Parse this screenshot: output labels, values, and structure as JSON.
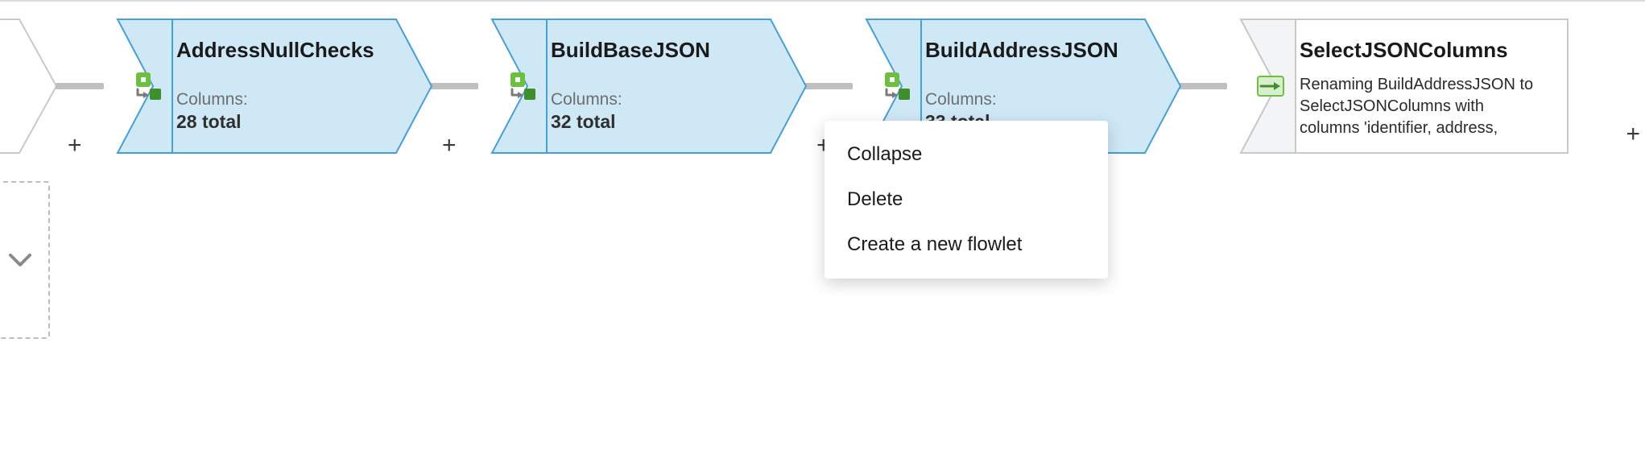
{
  "flow": {
    "source_fragment": {
      "plus_glyph": "+"
    },
    "nodes": [
      {
        "id": "n1",
        "kind": "derived",
        "title": "AddressNullChecks",
        "columns_label": "Columns:",
        "columns_count": "28 total",
        "icon_name": "derived-column-icon"
      },
      {
        "id": "n2",
        "kind": "derived",
        "title": "BuildBaseJSON",
        "columns_label": "Columns:",
        "columns_count": "32 total",
        "icon_name": "derived-column-icon"
      },
      {
        "id": "n3",
        "kind": "derived",
        "title": "BuildAddressJSON",
        "columns_label": "Columns:",
        "columns_count": "33 total",
        "icon_name": "derived-column-icon"
      },
      {
        "id": "n4",
        "kind": "select",
        "title": "SelectJSONColumns",
        "description": "Renaming BuildAddressJSON to SelectJSONColumns with columns 'identifier, address,",
        "icon_name": "select-icon"
      }
    ],
    "connector_plus": "+"
  },
  "context_menu": {
    "items": [
      {
        "label": "Collapse",
        "action": "collapse"
      },
      {
        "label": "Delete",
        "action": "delete"
      },
      {
        "label": "Create a new flowlet",
        "action": "create-flowlet"
      }
    ]
  },
  "drop_target": {
    "icon_name": "chevron-down-icon"
  },
  "trailing_plus": "+"
}
